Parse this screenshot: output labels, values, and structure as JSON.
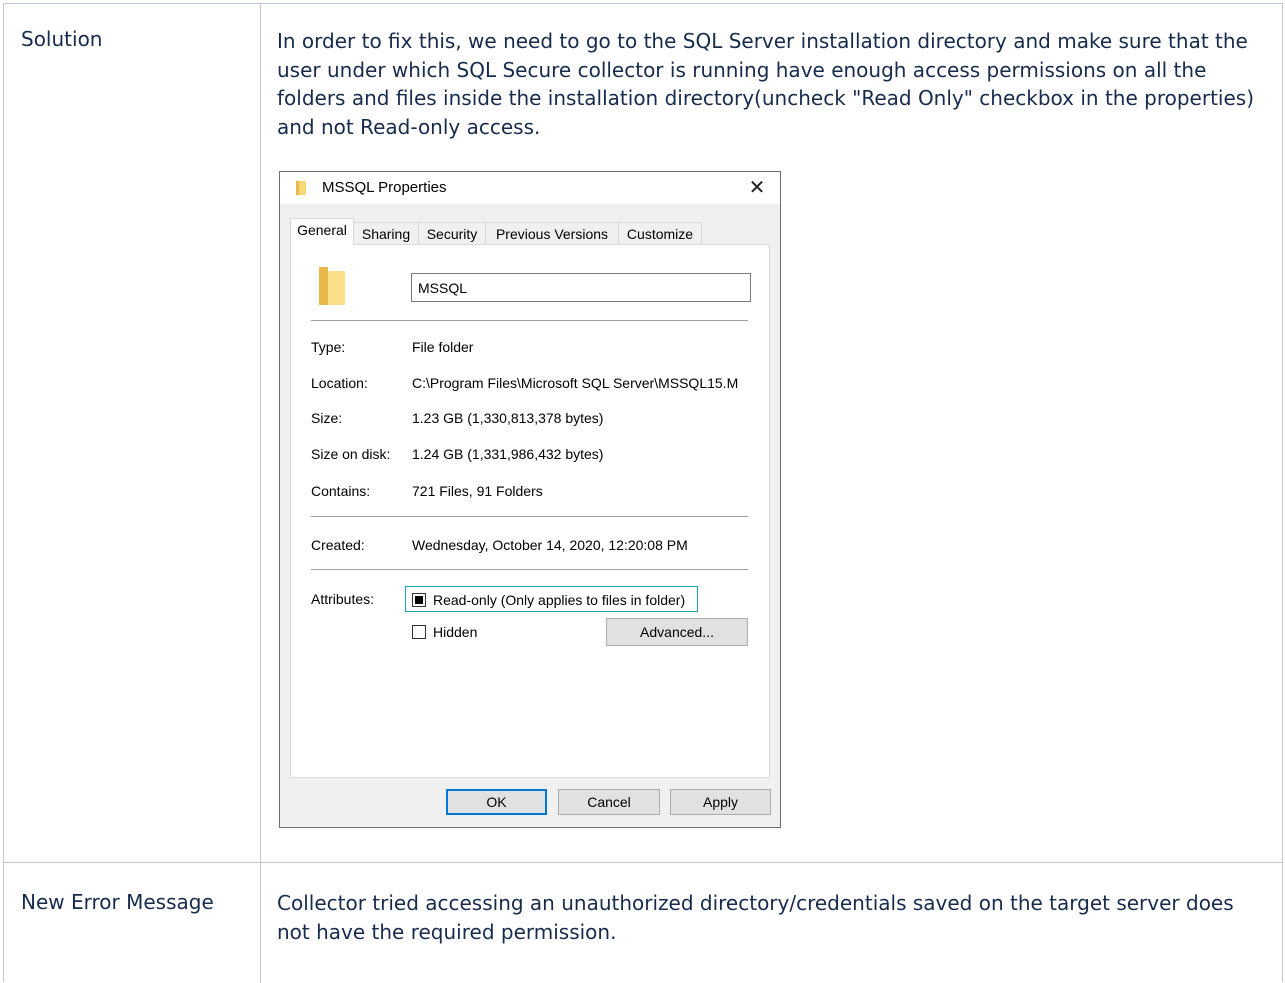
{
  "rows": [
    {
      "label": "Solution",
      "text": "In order to fix this, we need to go to the SQL Server installation directory and make sure that the user under which SQL Secure collector is running have enough access permissions on all the folders and files inside the installation directory(uncheck \"Read Only\" checkbox in the properties) and not Read-only access."
    },
    {
      "label": "New Error Message",
      "text": "Collector tried accessing an unauthorized directory/credentials saved on the target server does not have the required permission."
    }
  ],
  "dialog": {
    "title": "MSSQL Properties",
    "tabs": [
      "General",
      "Sharing",
      "Security",
      "Previous Versions",
      "Customize"
    ],
    "active_tab": "General",
    "folder_name": "MSSQL",
    "properties": {
      "type_label": "Type:",
      "type_value": "File folder",
      "location_label": "Location:",
      "location_value": "C:\\Program Files\\Microsoft SQL Server\\MSSQL15.M",
      "size_label": "Size:",
      "size_value": "1.23 GB (1,330,813,378 bytes)",
      "size_on_disk_label": "Size on disk:",
      "size_on_disk_value": "1.24 GB (1,331,986,432 bytes)",
      "contains_label": "Contains:",
      "contains_value": "721 Files, 91 Folders",
      "created_label": "Created:",
      "created_value": "Wednesday, October 14, 2020, 12:20:08 PM",
      "attributes_label": "Attributes:"
    },
    "readonly_label": "Read-only (Only applies to files in folder)",
    "readonly_checked": "indeterminate",
    "hidden_label": "Hidden",
    "hidden_checked": false,
    "advanced_label": "Advanced...",
    "ok_label": "OK",
    "cancel_label": "Cancel",
    "apply_label": "Apply"
  },
  "colors": {
    "border": "#c1c7d0",
    "text": "#172b4d",
    "focus": "#1aa3b6",
    "default_button": "#0078d7",
    "folder": "#f8d775"
  },
  "icons": [
    "folder-icon",
    "close-icon",
    "folder-large-icon"
  ]
}
